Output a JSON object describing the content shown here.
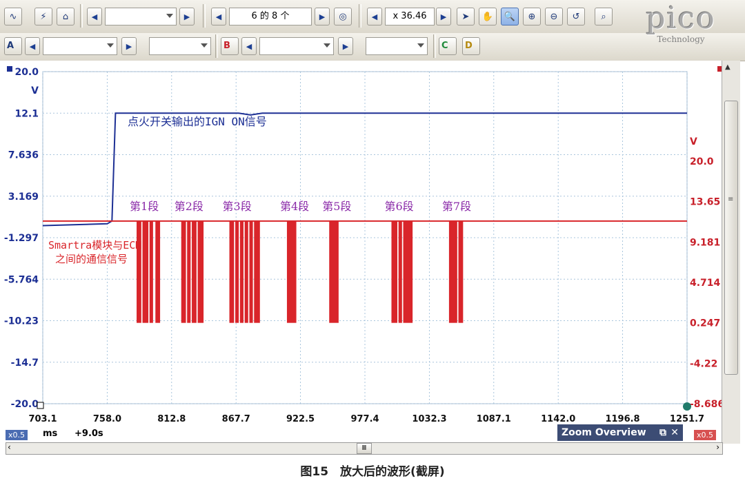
{
  "toolbar": {
    "buffer_label": "6 的 8 个",
    "zoom_value": "x 36.46"
  },
  "channels": {
    "a": "A",
    "b": "B",
    "c": "C",
    "d": "D"
  },
  "logo": {
    "name": "pico",
    "sub": "Technology"
  },
  "chart_data": {
    "type": "line",
    "x_unit": "ms",
    "x_ticks": [
      "703.1",
      "758.0",
      "812.8",
      "867.7",
      "922.5",
      "977.4",
      "1032.3",
      "1087.1",
      "1142.0",
      "1196.8",
      "1251.7"
    ],
    "xlim": [
      703.1,
      1251.7
    ],
    "left_axis": {
      "unit": "V",
      "ticks": [
        "20.0",
        "12.1",
        "7.636",
        "3.169",
        "-1.297",
        "-5.764",
        "-10.23",
        "-14.7",
        "-20.0"
      ]
    },
    "right_axis": {
      "unit": "V",
      "ticks": [
        "20.0",
        "13.65",
        "9.181",
        "4.714",
        "0.247",
        "-4.22",
        "-8.686"
      ]
    },
    "series": [
      {
        "name": "点火开关输出的IGN ON信号",
        "color": "#1c2f94",
        "points": [
          [
            703.1,
            0.0
          ],
          [
            758.0,
            0.2
          ],
          [
            762.0,
            0.5
          ],
          [
            765.0,
            12.1
          ],
          [
            870.0,
            12.1
          ],
          [
            880.0,
            11.9
          ],
          [
            890.0,
            12.1
          ],
          [
            1251.7,
            12.1
          ]
        ]
      },
      {
        "name": "Smartra模块与ECM之间的通信信号",
        "color": "#d9252a",
        "baseline": 11.5,
        "bursts": [
          {
            "label": "第1段",
            "segments": [
              [
                783.0,
                787.0
              ],
              [
                788.0,
                793.0
              ],
              [
                794.0,
                797.0
              ],
              [
                799.0,
                803.0
              ]
            ]
          },
          {
            "label": "第2段",
            "segments": [
              [
                821.0,
                825.0
              ],
              [
                826.0,
                829.0
              ],
              [
                830.0,
                834.0
              ],
              [
                835.0,
                840.0
              ]
            ]
          },
          {
            "label": "第3段",
            "segments": [
              [
                862.0,
                866.0
              ],
              [
                867.0,
                870.0
              ],
              [
                871.0,
                874.0
              ],
              [
                875.0,
                878.0
              ],
              [
                879.0,
                882.0
              ],
              [
                883.0,
                888.0
              ]
            ]
          },
          {
            "label": "第4段",
            "segments": [
              [
                911.0,
                919.0
              ]
            ]
          },
          {
            "label": "第5段",
            "segments": [
              [
                947.0,
                955.0
              ]
            ]
          },
          {
            "label": "第6段",
            "segments": [
              [
                1000.0,
                1005.0
              ],
              [
                1006.0,
                1009.0
              ],
              [
                1010.0,
                1018.0
              ]
            ]
          },
          {
            "label": "第7段",
            "segments": [
              [
                1049.0,
                1056.0
              ],
              [
                1057.0,
                1061.0
              ]
            ]
          }
        ],
        "low": -14.7
      }
    ]
  },
  "status": {
    "x_badge": "x0.5",
    "x_unit": "ms",
    "offset": "+9.0s",
    "zoom_overview": "Zoom Overview",
    "x_badge_right": "x0.5"
  },
  "caption": "图15　放大后的波形(截屏)"
}
